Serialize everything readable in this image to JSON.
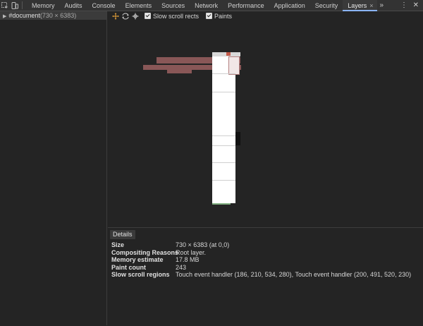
{
  "tabs": [
    {
      "label": "Memory",
      "active": false
    },
    {
      "label": "Audits",
      "active": false
    },
    {
      "label": "Console",
      "active": false
    },
    {
      "label": "Elements",
      "active": false
    },
    {
      "label": "Sources",
      "active": false
    },
    {
      "label": "Network",
      "active": false
    },
    {
      "label": "Performance",
      "active": false
    },
    {
      "label": "Application",
      "active": false
    },
    {
      "label": "Security",
      "active": false
    },
    {
      "label": "Layers",
      "active": true
    }
  ],
  "tabbar": {
    "more": "»",
    "menu": "⋮",
    "close": "✕",
    "tab_close": "×"
  },
  "tree": {
    "node": "#document",
    "size": "(730 × 6383)"
  },
  "toolbar": {
    "slow_scroll_label": "Slow scroll rects",
    "paints_label": "Paints",
    "slow_scroll_checked": true,
    "paints_checked": true
  },
  "details": {
    "tab": "Details",
    "rows": [
      {
        "key": "Size",
        "value": "730 × 6383 (at 0,0)"
      },
      {
        "key": "Compositing Reasons",
        "value": "Root layer."
      },
      {
        "key": "Memory estimate",
        "value": "17.8 MB"
      },
      {
        "key": "Paint count",
        "value": "243"
      },
      {
        "key": "Slow scroll regions",
        "value": "Touch event handler (186, 210, 534, 280), Touch event handler (200, 491, 520, 230)"
      }
    ]
  },
  "colors": {
    "slow_rect": "#9b6060",
    "accent": "#8ab4f8"
  },
  "icons": [
    "inspect-icon",
    "device-toolbar-icon",
    "pan-mode-icon",
    "rotate-mode-icon",
    "reset-transform-icon"
  ]
}
